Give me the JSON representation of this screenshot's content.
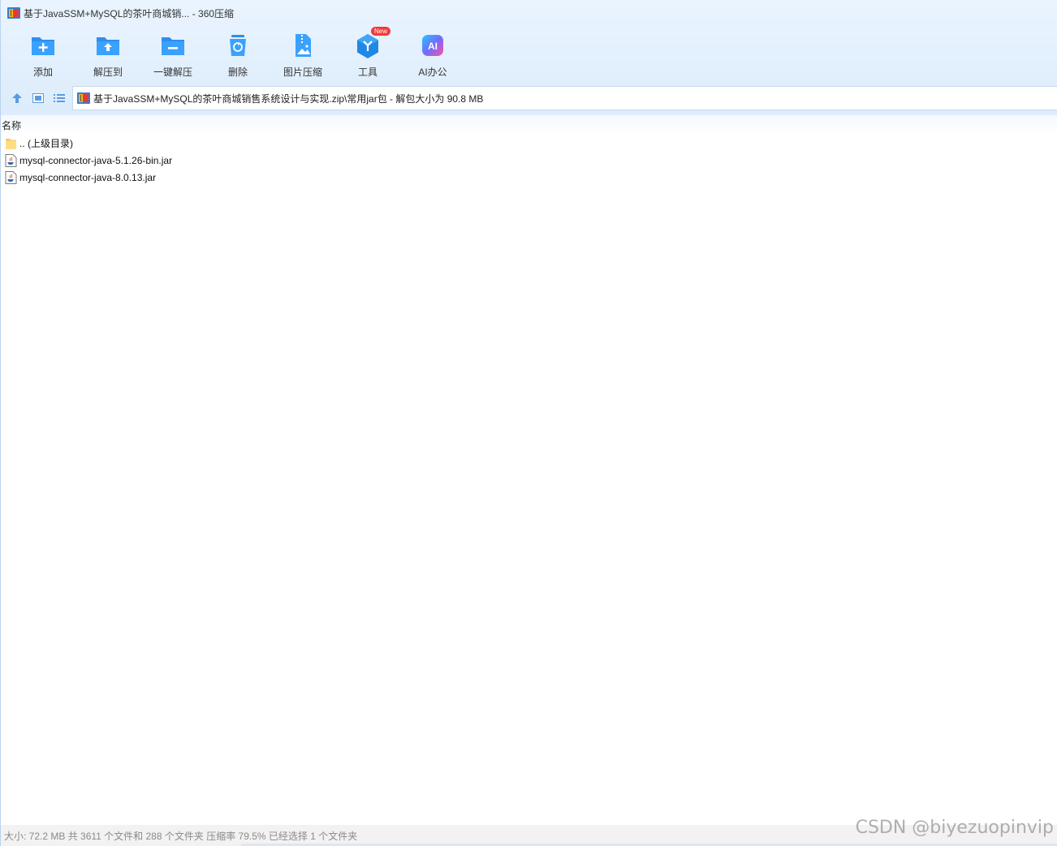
{
  "window": {
    "title": "基于JavaSSM+MySQL的茶叶商城销... - 360压缩"
  },
  "toolbar": {
    "items": [
      {
        "label": "添加",
        "icon": "add-folder-icon"
      },
      {
        "label": "解压到",
        "icon": "extract-to-icon"
      },
      {
        "label": "一键解压",
        "icon": "one-click-extract-icon"
      },
      {
        "label": "删除",
        "icon": "recycle-bin-icon"
      },
      {
        "label": "图片压缩",
        "icon": "image-compress-icon"
      },
      {
        "label": "工具",
        "icon": "tools-icon",
        "badge": "New"
      },
      {
        "label": "AI办公",
        "icon": "ai-office-icon"
      }
    ]
  },
  "nav": {
    "address": "基于JavaSSM+MySQL的茶叶商城销售系统设计与实现.zip\\常用jar包 - 解包大小为 90.8 MB"
  },
  "list": {
    "column_name": "名称",
    "rows": [
      {
        "name": ".. (上级目录)",
        "icon": "folder-icon"
      },
      {
        "name": "mysql-connector-java-5.1.26-bin.jar",
        "icon": "jar-file-icon"
      },
      {
        "name": "mysql-connector-java-8.0.13.jar",
        "icon": "jar-file-icon"
      }
    ]
  },
  "status": {
    "text": "大小: 72.2 MB 共 3611 个文件和 288 个文件夹 压缩率 79.5% 已经选择 1 个文件夹"
  },
  "watermark": "CSDN @biyezuopinvip",
  "colors": {
    "accent": "#2196f3",
    "header_bg": "#dcecfc",
    "badge": "#f23a3a"
  }
}
